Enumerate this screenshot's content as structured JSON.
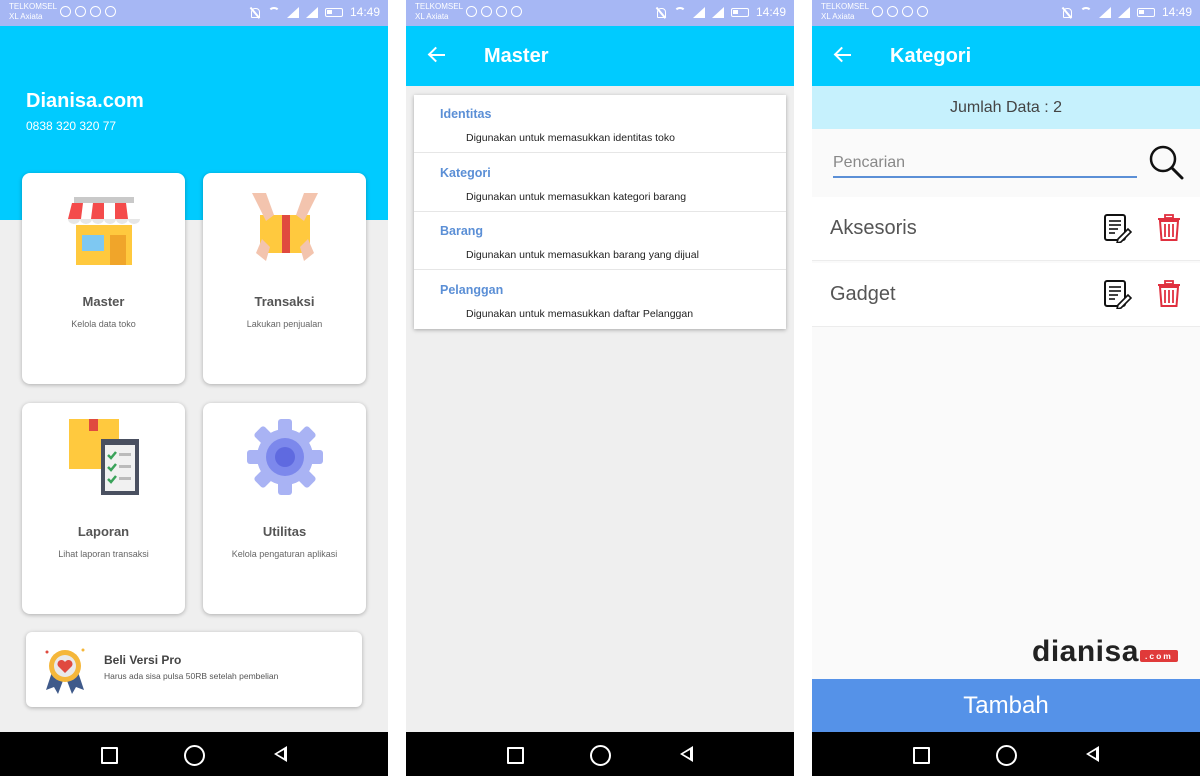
{
  "status_bar": {
    "carrier_line1": "TELKOMSEL",
    "carrier_line2": "XL Axiata",
    "time": "14:49",
    "icons": [
      "chat-icon",
      "play-icon",
      "instagram-icon",
      "circle-icon",
      "mute-icon",
      "wifi-icon",
      "signal-icon",
      "signal-icon",
      "battery-icon"
    ]
  },
  "nav_bar": {
    "icons": [
      "recent-apps-icon",
      "home-icon",
      "back-icon"
    ]
  },
  "screen_home": {
    "brand": "Dianisa.com",
    "phone": "0838 320 320 77",
    "cards": [
      {
        "title": "Master",
        "subtitle": "Kelola data toko",
        "icon": "store-icon"
      },
      {
        "title": "Transaksi",
        "subtitle": "Lakukan penjualan",
        "icon": "box-hands-icon"
      },
      {
        "title": "Laporan",
        "subtitle": "Lihat laporan transaksi",
        "icon": "report-clipboard-icon"
      },
      {
        "title": "Utilitas",
        "subtitle": "Kelola pengaturan aplikasi",
        "icon": "gear-icon"
      }
    ],
    "pro": {
      "title": "Beli Versi Pro",
      "subtitle": "Harus ada sisa pulsa 50RB setelah pembelian",
      "icon": "award-badge-icon"
    }
  },
  "screen_master": {
    "title": "Master",
    "items": [
      {
        "title": "Identitas",
        "desc": "Digunakan untuk memasukkan identitas toko"
      },
      {
        "title": "Kategori",
        "desc": "Digunakan untuk memasukkan kategori barang"
      },
      {
        "title": "Barang",
        "desc": "Digunakan untuk memasukkan barang yang dijual"
      },
      {
        "title": "Pelanggan",
        "desc": "Digunakan untuk memasukkan daftar Pelanggan"
      }
    ]
  },
  "screen_kategori": {
    "title": "Kategori",
    "count_label": "Jumlah Data : 2",
    "search_placeholder": "Pencarian",
    "rows": [
      {
        "label": "Aksesoris"
      },
      {
        "label": "Gadget"
      }
    ],
    "watermark_main": "dianisa",
    "watermark_suffix": ".com",
    "add_button": "Tambah"
  },
  "colors": {
    "primary": "#00cbff",
    "accent": "#5b8fd6",
    "button": "#5592e8",
    "delete": "#e0303f",
    "status_bar": "#a6b7f4"
  }
}
